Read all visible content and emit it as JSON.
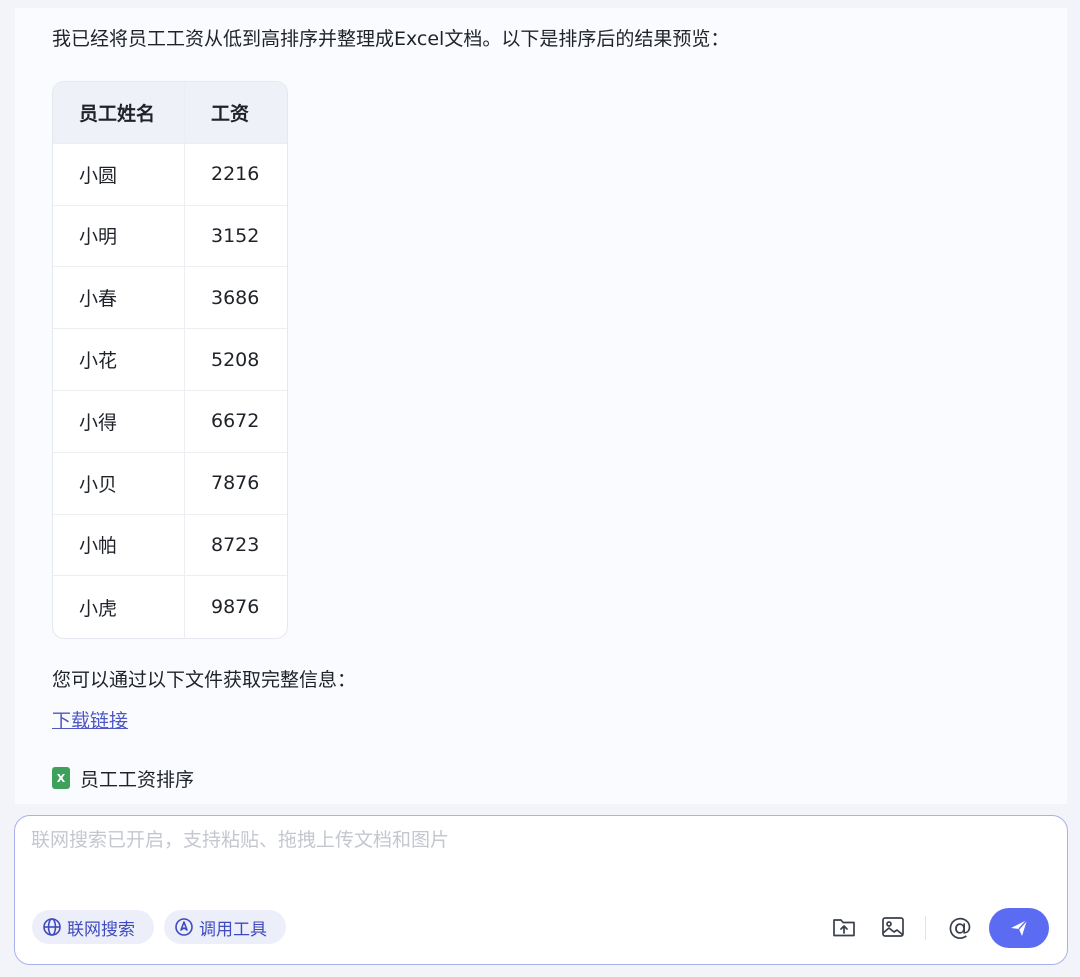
{
  "message": {
    "intro": "我已经将员工工资从低到高排序并整理成Excel文档。以下是排序后的结果预览：",
    "table": {
      "headers": [
        "员工姓名",
        "工资"
      ],
      "rows": [
        [
          "小圆",
          "2216"
        ],
        [
          "小明",
          "3152"
        ],
        [
          "小春",
          "3686"
        ],
        [
          "小花",
          "5208"
        ],
        [
          "小得",
          "6672"
        ],
        [
          "小贝",
          "7876"
        ],
        [
          "小帕",
          "8723"
        ],
        [
          "小虎",
          "9876"
        ]
      ]
    },
    "access_text": "您可以通过以下文件获取完整信息：",
    "download_label": "下载链接",
    "file": {
      "icon": "excel-file-icon",
      "icon_letter": "X",
      "name": "员工工资排序"
    }
  },
  "composer": {
    "placeholder": "联网搜索已开启，支持粘贴、拖拽上传文档和图片",
    "web_search_label": "联网搜索",
    "tools_label": "调用工具",
    "mention_symbol": "@"
  },
  "colors": {
    "accent": "#5b6cf2",
    "link": "#4d56c4",
    "pill_bg": "#eceff9",
    "excel_green": "#3fa05b"
  }
}
